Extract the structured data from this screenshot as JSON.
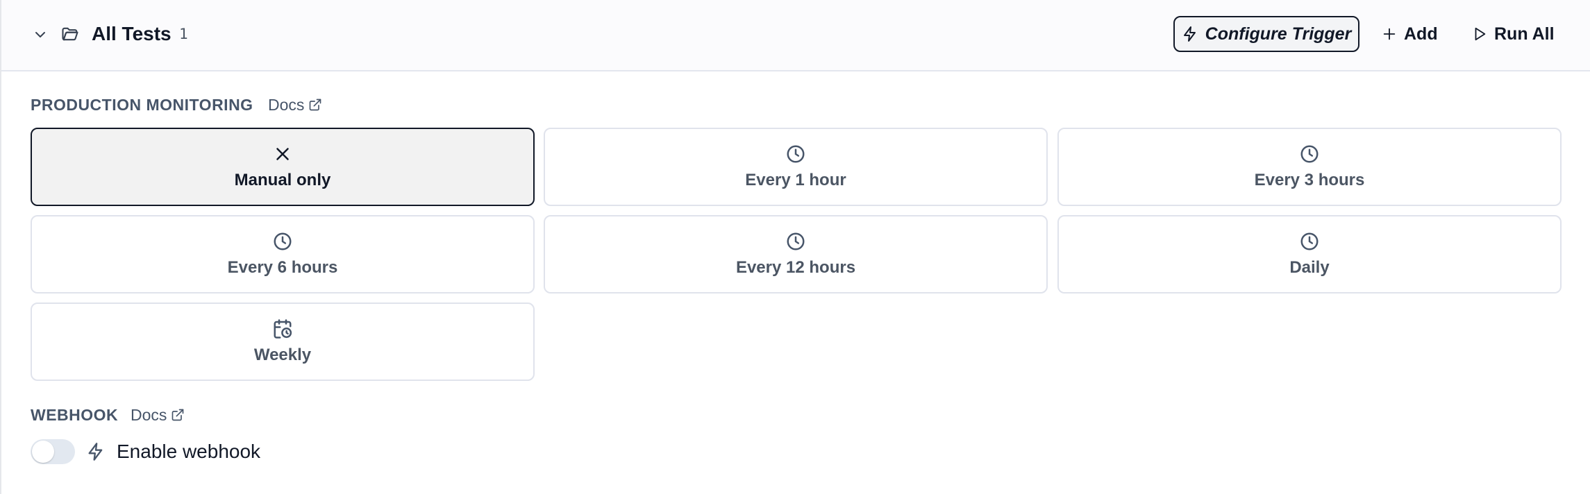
{
  "header": {
    "title": "All Tests",
    "count": "1",
    "configure_trigger": "Configure Trigger",
    "add": "Add",
    "run_all": "Run All"
  },
  "production": {
    "label": "PRODUCTION MONITORING",
    "docs": "Docs",
    "options": [
      {
        "label": "Manual only",
        "icon": "close-icon",
        "selected": true
      },
      {
        "label": "Every 1 hour",
        "icon": "clock-icon",
        "selected": false
      },
      {
        "label": "Every 3 hours",
        "icon": "clock-icon",
        "selected": false
      },
      {
        "label": "Every 6 hours",
        "icon": "clock-icon",
        "selected": false
      },
      {
        "label": "Every 12 hours",
        "icon": "clock-icon",
        "selected": false
      },
      {
        "label": "Daily",
        "icon": "clock-icon",
        "selected": false
      },
      {
        "label": "Weekly",
        "icon": "calendar-clock-icon",
        "selected": false
      }
    ]
  },
  "webhook": {
    "label": "WEBHOOK",
    "docs": "Docs",
    "enable_label": "Enable webhook",
    "enabled": false
  },
  "colors": {
    "text": "#111827",
    "muted": "#4b5563",
    "border": "#e0e3ec",
    "selected_bg": "#f2f2f2",
    "toggle_off": "#e2e8f0"
  }
}
